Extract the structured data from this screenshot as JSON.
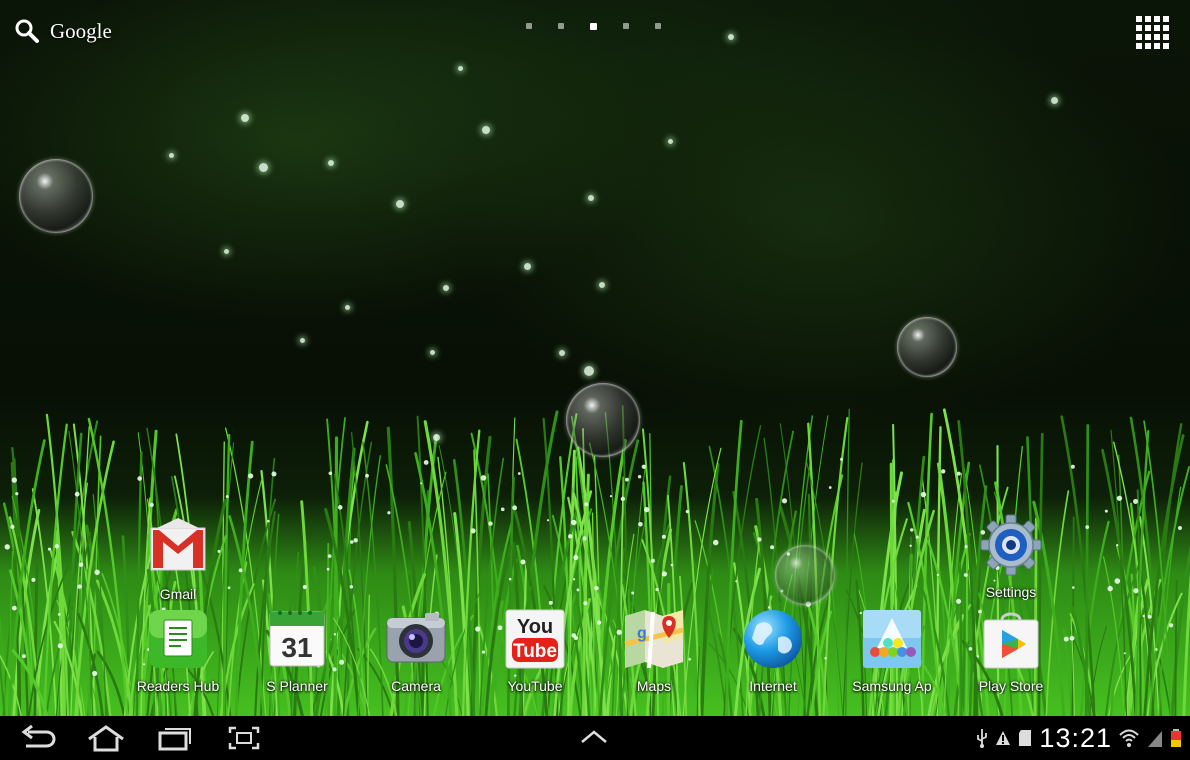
{
  "search": {
    "label": "Google",
    "icon": "search-icon"
  },
  "pager": {
    "count": 5,
    "active_index": 2
  },
  "top_apps": [
    {
      "label": "Gmail",
      "icon": "gmail-icon"
    },
    {
      "label": "Settings",
      "icon": "settings-icon"
    }
  ],
  "dock_apps": [
    {
      "label": "Readers Hub",
      "icon": "readers-hub-icon"
    },
    {
      "label": "S Planner",
      "icon": "s-planner-icon",
      "date": "31"
    },
    {
      "label": "Camera",
      "icon": "camera-icon"
    },
    {
      "label": "YouTube",
      "icon": "youtube-icon",
      "logo_top": "You",
      "logo_bottom": "Tube"
    },
    {
      "label": "Maps",
      "icon": "maps-icon"
    },
    {
      "label": "Internet",
      "icon": "internet-icon"
    },
    {
      "label": "Samsung Ap",
      "icon": "samsung-apps-icon"
    },
    {
      "label": "Play Store",
      "icon": "play-store-icon"
    }
  ],
  "status_bar": {
    "time": "13:21",
    "icons": [
      "usb-icon",
      "warning-icon",
      "sd-card-icon",
      "wifi-icon",
      "signal-icon",
      "battery-icon"
    ]
  },
  "colors": {
    "grass": "#3fae1e",
    "wallpaper_dark": "#081005",
    "gmail_red": "#d93025",
    "youtube_red": "#e62117"
  }
}
